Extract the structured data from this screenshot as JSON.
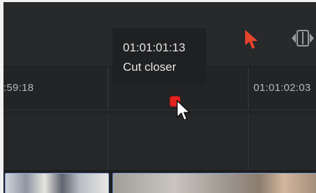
{
  "tooltip": {
    "timecode": "01:01:01:13",
    "marker_note": "Cut closer"
  },
  "ruler": {
    "timecodes": [
      ":59:18",
      "01:01:02:03"
    ]
  },
  "colors": {
    "marker": "#e0241f",
    "clip_border": "#7c9ad1",
    "panel_bg": "#28292b"
  },
  "icons": {
    "flag_pointer": "red-arrow-icon",
    "trim": "trim-handle-icon",
    "cursor": "mouse-pointer-icon"
  }
}
